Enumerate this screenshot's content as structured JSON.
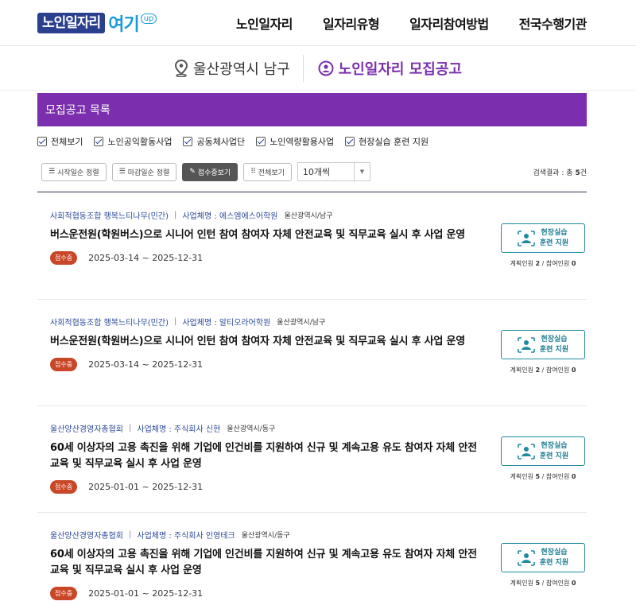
{
  "logo": {
    "brand": "노인일자리",
    "suffix": "여기",
    "tag": "up"
  },
  "nav": [
    "노인일자리",
    "일자리유형",
    "일자리참여방법",
    "전국수행기관"
  ],
  "region": {
    "location": "울산광역시 남구",
    "board": "노인일자리 모집공고"
  },
  "section": {
    "title": "모집공고 목록"
  },
  "filters": [
    "전체보기",
    "노인공익활동사업",
    "공동체사업단",
    "노인역량활용사업",
    "현장실습 훈련 지원"
  ],
  "toolbar": {
    "sort_start": "시작일순 정렬",
    "sort_end": "마감일순 정렬",
    "receiving": "접수중보기",
    "view_all": "전체보기",
    "page_size": "10개씩",
    "result_prefix": "검색결과 : 총 ",
    "result_count": "5",
    "result_suffix": "건"
  },
  "jobs": [
    {
      "org": "사회적협동조합 행복느티나무(민간)",
      "company": "사업체명 : 에스엠에스어학원",
      "location": "울산광역시/남구",
      "title": "버스운전원(학원버스)으로 시니어 인턴 참여 참여자 자체 안전교육 및 직무교육 실시 후 사업 운영",
      "status": "접수중",
      "period": "2025-03-14 ~ 2025-12-31",
      "type_line1": "현장실습",
      "type_line2": "훈련 지원",
      "planned_label": "계획인원",
      "planned": "2",
      "joined_label": "참여인원",
      "joined": "0"
    },
    {
      "org": "사회적협동조합 행복느티나무(민간)",
      "company": "사업체명 : 알티오라어학원",
      "location": "울산광역시/남구",
      "title": "버스운전원(학원버스)으로 시니어 인턴 참여 참여자 자체 안전교육 및 직무교육 실시 후 사업 운영",
      "status": "접수중",
      "period": "2025-03-14 ~ 2025-12-31",
      "type_line1": "현장실습",
      "type_line2": "훈련 지원",
      "planned_label": "계획인원",
      "planned": "2",
      "joined_label": "참여인원",
      "joined": "0"
    },
    {
      "org": "울산양산경영자총협회",
      "company": "사업체명 : 주식회사 신현",
      "location": "울산광역시/동구",
      "title": "60세 이상자의 고용 촉진을 위해 기업에 인건비를 지원하여 신규 및 계속고용 유도 참여자 자체 안전교육 및 직무교육 실시 후 사업 운영",
      "status": "접수중",
      "period": "2025-01-01 ~ 2025-12-31",
      "type_line1": "현장실습",
      "type_line2": "훈련 지원",
      "planned_label": "계획인원",
      "planned": "5",
      "joined_label": "참여인원",
      "joined": "0"
    },
    {
      "org": "울산양산경영자총협회",
      "company": "사업체명 : 주식회사 인영테크",
      "location": "울산광역시/동구",
      "title": "60세 이상자의 고용 촉진을 위해 기업에 인건비를 지원하여 신규 및 계속고용 유도 참여자 자체 안전교육 및 직무교육 실시 후 사업 운영",
      "status": "접수중",
      "period": "2025-01-01 ~ 2025-12-31",
      "type_line1": "현장실습",
      "type_line2": "훈련 지원",
      "planned_label": "계획인원",
      "planned": "5",
      "joined_label": "참여인원",
      "joined": "0"
    }
  ],
  "colors": {
    "accent": "#7b2fae",
    "brand": "#2b3f8f",
    "badge": "#c94727",
    "train": "#1e8aa0"
  }
}
